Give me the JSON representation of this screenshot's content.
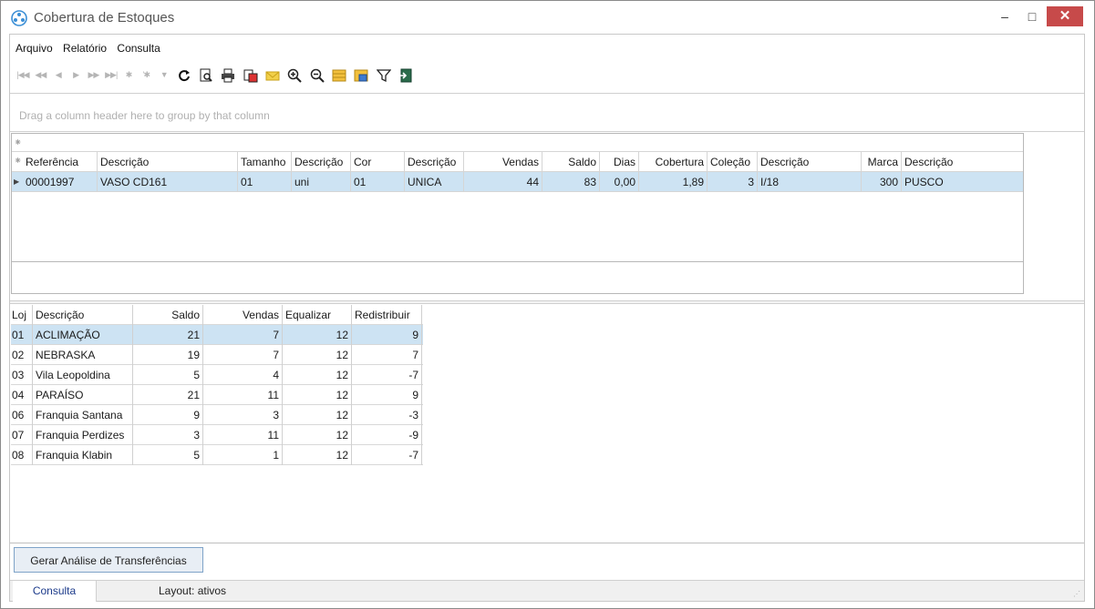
{
  "window": {
    "title": "Cobertura de Estoques",
    "minimize": "–",
    "maximize": "□",
    "close": "✕"
  },
  "menu": [
    "Arquivo",
    "Relatório",
    "Consulta"
  ],
  "group_panel": {
    "text": "Drag a column header here to group by that column"
  },
  "main_grid": {
    "filter_marker": "⁕",
    "header_marker": "⁕",
    "columns": [
      "Referência",
      "Descrição",
      "Tamanho",
      "Descrição",
      "Cor",
      "Descrição",
      "Vendas",
      "Saldo",
      "Dias",
      "Cobertura",
      "Coleção",
      "Descrição",
      "Marca",
      "Descrição"
    ],
    "rows": [
      [
        "00001997",
        "VASO CD161",
        "01",
        "uni",
        "01",
        "UNICA",
        "44",
        "83",
        "0,00",
        "1,89",
        "3",
        "I/18",
        "300",
        "PUSCO"
      ]
    ]
  },
  "store_grid": {
    "columns": [
      "Loj",
      "Descrição",
      "Saldo",
      "Vendas",
      "Equalizar",
      "Redistribuir"
    ],
    "rows": [
      [
        "01",
        "ACLIMAÇÃO",
        "21",
        "7",
        "12",
        "9"
      ],
      [
        "02",
        "NEBRASKA",
        "19",
        "7",
        "12",
        "7"
      ],
      [
        "03",
        "Vila Leopoldina",
        "5",
        "4",
        "12",
        "-7"
      ],
      [
        "04",
        "PARAÍSO",
        "21",
        "11",
        "12",
        "9"
      ],
      [
        "06",
        "Franquia Santana",
        "9",
        "3",
        "12",
        "-3"
      ],
      [
        "07",
        "Franquia Perdizes",
        "3",
        "11",
        "12",
        "-9"
      ],
      [
        "08",
        "Franquia Klabin",
        "5",
        "1",
        "12",
        "-7"
      ]
    ]
  },
  "buttons": {
    "generate": "Gerar Análise de Transferências"
  },
  "status": {
    "tab": "Consulta",
    "layout": "Layout: ativos"
  },
  "colors": {
    "selection": "#cde3f3",
    "close_button": "#c74a4a"
  }
}
